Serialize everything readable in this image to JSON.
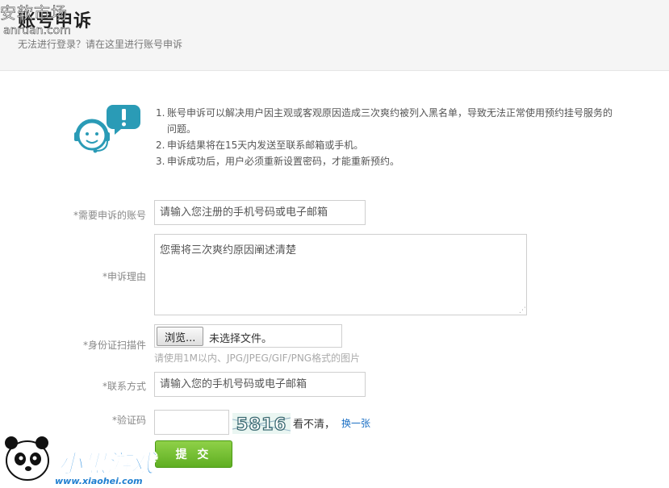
{
  "watermark_top": {
    "name": "安软市场",
    "url": "anruan.com"
  },
  "header": {
    "title": "账号申诉",
    "subtitle": "无法进行登录？请在这里进行账号申诉"
  },
  "notes": [
    {
      "num": "1.",
      "text": "账号申诉可以解决用户因主观或客观原因造成三次爽约被列入黑名单，导致无法正常使用预约挂号服务的问题。"
    },
    {
      "num": "2.",
      "text": "申诉结果将在15天内发送至联系邮箱或手机。"
    },
    {
      "num": "3.",
      "text": "申诉成功后，用户必须重新设置密码，才能重新预约。"
    }
  ],
  "form": {
    "account_label": "*需要申诉的账号",
    "account_placeholder": "请输入您注册的手机号码或电子邮箱",
    "reason_label": "*申诉理由",
    "reason_placeholder": "您需将三次爽约原因阐述清楚",
    "id_label": "*身份证扫描件",
    "browse_label": "浏览...",
    "file_status": "未选择文件。",
    "file_hint": "请使用1M以内、JPG/JPEG/GIF/PNG格式的图片",
    "contact_label": "*联系方式",
    "contact_placeholder": "请输入您的手机号码或电子邮箱",
    "captcha_label": "*验证码",
    "captcha_code": "5816",
    "captcha_unclear": "看不清，",
    "captcha_refresh": "换一张",
    "submit_label": "提 交"
  },
  "watermark_bottom": {
    "brand": "小黑游戏",
    "url": "www.xiaohei.com"
  },
  "colors": {
    "accent_link": "#1a6fc4",
    "submit_green": "#5fae22",
    "illustration_teal": "#2a9bb6"
  }
}
